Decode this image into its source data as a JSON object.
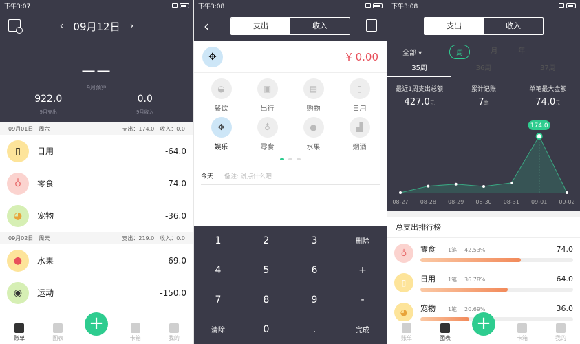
{
  "status_times": [
    "下午3:07",
    "下午3:08",
    "下午3:08"
  ],
  "colors": {
    "dark_bg": "#3a3a48",
    "accent": "#2ecc8f",
    "amount_red": "#e8505b"
  },
  "screen1": {
    "date": "09月12日",
    "prev_arrow": "‹",
    "next_arrow": "›",
    "budget_value": "——",
    "budget_label": "9月预算",
    "total_expense": "922.0",
    "total_expense_label": "9月支出",
    "total_income": "0.0",
    "total_income_label": "9月收入",
    "days": [
      {
        "date": "09月01日",
        "weekday": "周六",
        "summary": "支出：174.0　收入：0.0",
        "records": [
          {
            "icon": "daily-use-icon",
            "glyph": "▯",
            "bg": "#fde49a",
            "name": "日用",
            "amount": "-64.0"
          },
          {
            "icon": "snack-icon",
            "glyph": "♁",
            "bg": "#fbd3cf",
            "name": "零食",
            "amount": "-74.0"
          },
          {
            "icon": "pet-icon",
            "glyph": "◕",
            "bg": "#d6efb4",
            "name": "宠物",
            "amount": "-36.0"
          }
        ]
      },
      {
        "date": "09月02日",
        "weekday": "周天",
        "summary": "支出：219.0　收入：0.0",
        "records": [
          {
            "icon": "fruit-icon",
            "glyph": "●",
            "bg": "#fde49a",
            "name": "水果",
            "amount": "-69.0"
          },
          {
            "icon": "sport-icon",
            "glyph": "◉",
            "bg": "#d6efb4",
            "name": "运动",
            "amount": "-150.0"
          }
        ]
      }
    ],
    "tabs": [
      "账单",
      "图表",
      "卡箱",
      "我的"
    ]
  },
  "screen2": {
    "back": "‹",
    "seg_expense": "支出",
    "seg_income": "收入",
    "amount": "¥ 0.00",
    "categories": [
      {
        "label": "餐饮",
        "icon": "dining-icon",
        "glyph": "◒",
        "selected": false
      },
      {
        "label": "出行",
        "icon": "transport-icon",
        "glyph": "▣",
        "selected": false
      },
      {
        "label": "购物",
        "icon": "shopping-icon",
        "glyph": "▤",
        "selected": false
      },
      {
        "label": "日用",
        "icon": "daily-use-icon",
        "glyph": "▯",
        "selected": false
      },
      {
        "label": "娱乐",
        "icon": "gamepad-icon",
        "glyph": "✥",
        "selected": true
      },
      {
        "label": "零食",
        "icon": "snack-icon",
        "glyph": "♁",
        "selected": false
      },
      {
        "label": "水果",
        "icon": "fruit-icon",
        "glyph": "●",
        "selected": false
      },
      {
        "label": "烟酒",
        "icon": "alcohol-icon",
        "glyph": "▟",
        "selected": false
      }
    ],
    "note_label": "今天",
    "note_placeholder": "备注: 说点什么吧",
    "keys": [
      "1",
      "2",
      "3",
      "删除",
      "4",
      "5",
      "6",
      "+",
      "7",
      "8",
      "9",
      "-",
      "清除",
      "0",
      ".",
      "完成"
    ]
  },
  "screen3": {
    "seg_expense": "支出",
    "seg_income": "收入",
    "filter_all": "全部",
    "period_week": "周",
    "period_month": "月",
    "period_year": "年",
    "weeks": [
      "35周",
      "36周",
      "37周"
    ],
    "summary": [
      {
        "label": "最近1周支出总额",
        "value": "427.0",
        "unit": "元"
      },
      {
        "label": "累计记账",
        "value": "7",
        "unit": "笔"
      },
      {
        "label": "单笔最大金额",
        "value": "74.0",
        "unit": "元"
      }
    ],
    "chart_data": {
      "type": "line",
      "categories": [
        "08-27",
        "08-28",
        "08-29",
        "08-30",
        "08-31",
        "09-01",
        "09-02"
      ],
      "values": [
        0,
        20,
        26,
        19,
        30,
        174,
        0
      ],
      "highlight_label": "174.0",
      "highlight_index": 5
    },
    "rank_title": "总支出排行榜",
    "rank": [
      {
        "icon": "snack-icon",
        "glyph": "♁",
        "bg": "#fbd3cf",
        "name": "零食",
        "count": "1笔",
        "pct": "42.53%",
        "pct_value": 42.53,
        "amount": "74.0"
      },
      {
        "icon": "daily-use-icon",
        "glyph": "▯",
        "bg": "#fde49a",
        "name": "日用",
        "count": "1笔",
        "pct": "36.78%",
        "pct_value": 36.78,
        "amount": "64.0"
      },
      {
        "icon": "pet-icon",
        "glyph": "◕",
        "bg": "#fde49a",
        "name": "宠物",
        "count": "1笔",
        "pct": "20.69%",
        "pct_value": 20.69,
        "amount": "36.0"
      }
    ],
    "tabs": [
      "账单",
      "图表",
      "卡箱",
      "我的"
    ]
  }
}
